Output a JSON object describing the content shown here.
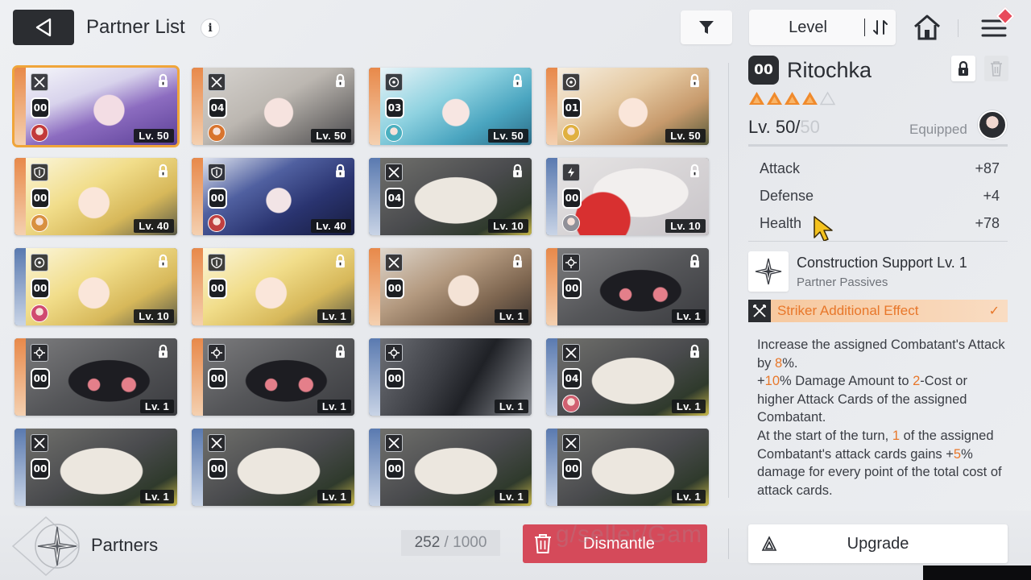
{
  "header": {
    "title": "Partner List",
    "info_glyph": "i",
    "sort_label": "Level"
  },
  "cards": [
    {
      "id": "00",
      "level": "Lv. 50",
      "strip": "#e8894a",
      "cls": "crossed-swords",
      "lock": true,
      "selected": true,
      "art": "purple"
    },
    {
      "id": "04",
      "level": "Lv. 50",
      "strip": "#e8894a",
      "cls": "crossed-swords",
      "lock": true,
      "selected": false,
      "art": "silver"
    },
    {
      "id": "03",
      "level": "Lv. 50",
      "strip": "#e8894a",
      "cls": "target",
      "lock": true,
      "selected": false,
      "art": "cyan"
    },
    {
      "id": "01",
      "level": "Lv. 50",
      "strip": "#e8894a",
      "cls": "target",
      "lock": true,
      "selected": false,
      "art": "blonde"
    },
    {
      "id": "00",
      "level": "Lv. 40",
      "strip": "#e8894a",
      "cls": "shield",
      "lock": true,
      "selected": false,
      "art": "yellow"
    },
    {
      "id": "00",
      "level": "Lv. 40",
      "strip": "#e8894a",
      "cls": "shield",
      "lock": true,
      "selected": false,
      "art": "navy"
    },
    {
      "id": "04",
      "level": "Lv. 10",
      "strip": "#5a7ab0",
      "cls": "crossed-swords",
      "lock": true,
      "selected": false,
      "art": "mascot"
    },
    {
      "id": "00",
      "level": "Lv. 10",
      "strip": "#5a7ab0",
      "cls": "lightning",
      "lock": true,
      "selected": false,
      "art": "fox"
    },
    {
      "id": "00",
      "level": "Lv. 10",
      "strip": "#5a7ab0",
      "cls": "target",
      "lock": true,
      "selected": false,
      "art": "yellow"
    },
    {
      "id": "00",
      "level": "Lv. 1",
      "strip": "#e8894a",
      "cls": "shield",
      "lock": true,
      "selected": false,
      "art": "yellow"
    },
    {
      "id": "00",
      "level": "Lv. 1",
      "strip": "#e8894a",
      "cls": "crossed-swords",
      "lock": true,
      "selected": false,
      "art": "brown"
    },
    {
      "id": "00",
      "level": "Lv. 1",
      "strip": "#e8894a",
      "cls": "target-dot",
      "lock": true,
      "selected": false,
      "art": "creature"
    },
    {
      "id": "00",
      "level": "Lv. 1",
      "strip": "#e8894a",
      "cls": "target-dot",
      "lock": true,
      "selected": false,
      "art": "creature"
    },
    {
      "id": "00",
      "level": "Lv. 1",
      "strip": "#e8894a",
      "cls": "target-dot",
      "lock": true,
      "selected": false,
      "art": "creature"
    },
    {
      "id": "00",
      "level": "Lv. 1",
      "strip": "#5a7ab0",
      "cls": "target-dot",
      "lock": false,
      "selected": false,
      "art": "feather"
    },
    {
      "id": "04",
      "level": "Lv. 1",
      "strip": "#5a7ab0",
      "cls": "crossed-swords",
      "lock": true,
      "selected": false,
      "art": "mascot"
    },
    {
      "id": "00",
      "level": "Lv. 1",
      "strip": "#5a7ab0",
      "cls": "crossed-swords",
      "lock": false,
      "selected": false,
      "art": "mascot"
    },
    {
      "id": "00",
      "level": "Lv. 1",
      "strip": "#5a7ab0",
      "cls": "crossed-swords",
      "lock": false,
      "selected": false,
      "art": "mascot"
    },
    {
      "id": "00",
      "level": "Lv. 1",
      "strip": "#5a7ab0",
      "cls": "crossed-swords",
      "lock": false,
      "selected": false,
      "art": "mascot"
    },
    {
      "id": "00",
      "level": "Lv. 1",
      "strip": "#5a7ab0",
      "cls": "crossed-swords",
      "lock": false,
      "selected": false,
      "art": "mascot"
    }
  ],
  "detail": {
    "badge": "00",
    "name": "Ritochka",
    "stars_filled": 4,
    "stars_total": 5,
    "level_prefix": "Lv. 50/",
    "level_max": "50",
    "equipped_label": "Equipped",
    "stats": [
      {
        "label": "Attack",
        "value": "+87"
      },
      {
        "label": "Defense",
        "value": "+4"
      },
      {
        "label": "Health",
        "value": "+78"
      }
    ],
    "skill_title": "Construction Support Lv. 1",
    "skill_subtitle": "Partner Passives",
    "striker_label": "Striker Additional Effect",
    "description": [
      {
        "t": "Increase the assigned Combatant's Attack by ",
        "h": false
      },
      {
        "t": "8",
        "h": true
      },
      {
        "t": "%.",
        "h": false
      },
      {
        "t": "\n+",
        "h": false
      },
      {
        "t": "10",
        "h": true
      },
      {
        "t": "% Damage Amount to ",
        "h": false
      },
      {
        "t": "2",
        "h": true
      },
      {
        "t": "-Cost or higher Attack Cards of the assigned Combatant.",
        "h": false
      },
      {
        "t": "\nAt the start of the turn, ",
        "h": false
      },
      {
        "t": "1",
        "h": true
      },
      {
        "t": " of the assigned Combatant's attack cards gains +",
        "h": false
      },
      {
        "t": "5",
        "h": true
      },
      {
        "t": "% damage for every point of the total cost of attack cards.",
        "h": false
      }
    ]
  },
  "footer": {
    "partners_label": "Partners",
    "count_current": "252",
    "count_sep": " / ",
    "count_max": "1000",
    "dismantle_label": "Dismantle",
    "upgrade_label": "Upgrade",
    "watermark": "g/seller/Gam"
  },
  "colors": {
    "accent_orange": "#e8772a",
    "dismantle_red": "#d54a5a",
    "selected_outline": "#f0a53a",
    "dark": "#2b2d31"
  }
}
